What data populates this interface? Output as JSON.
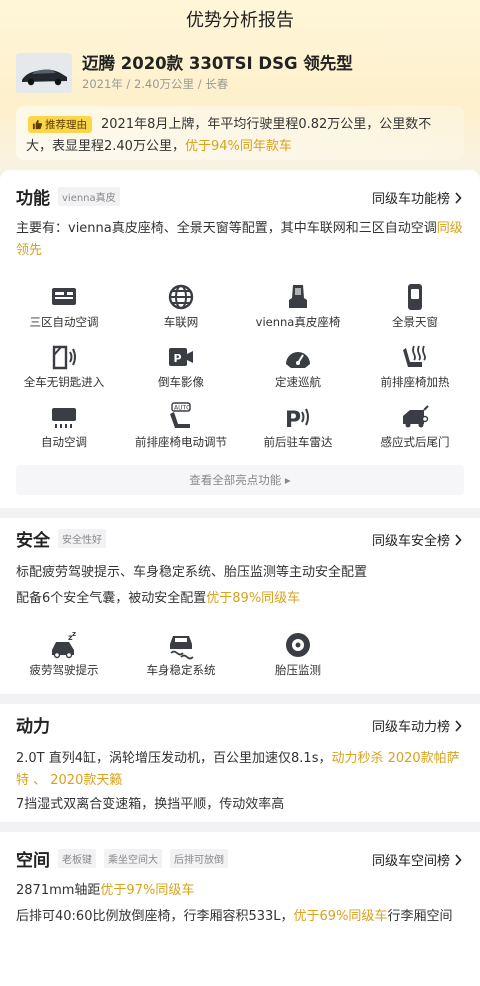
{
  "header": {
    "title": "优势分析报告"
  },
  "car": {
    "name": "迈腾 2020款 330TSI DSG 领先型",
    "meta": "2021年 / 2.40万公里 / 长春"
  },
  "reason": {
    "badge": "推荐理由",
    "text_plain": "2021年8月上牌，年平均行驶里程0.82万公里，公里数不大，表显里程2.40万公里，",
    "text_highlight": "优于94%同年款车"
  },
  "features": {
    "title": "功能",
    "tag": "vienna真皮",
    "rank_link": "同级车功能榜",
    "summary_plain": "主要有：vienna真皮座椅、全景天窗等配置，其中车联网和三区自动空调",
    "summary_highlight": "同级领先",
    "items": [
      {
        "label": "三区自动空调",
        "icon": "climate-panel-icon"
      },
      {
        "label": "车联网",
        "icon": "globe-icon"
      },
      {
        "label": "vienna真皮座椅",
        "icon": "seat-icon"
      },
      {
        "label": "全景天窗",
        "icon": "sunroof-icon"
      },
      {
        "label": "全车无钥匙进入",
        "icon": "door-key-icon"
      },
      {
        "label": "倒车影像",
        "icon": "reverse-camera-icon"
      },
      {
        "label": "定速巡航",
        "icon": "cruise-gauge-icon"
      },
      {
        "label": "前排座椅加热",
        "icon": "seat-heat-icon"
      },
      {
        "label": "自动空调",
        "icon": "ac-vent-icon"
      },
      {
        "label": "前排座椅电动调节",
        "icon": "power-seat-icon"
      },
      {
        "label": "前后驻车雷达",
        "icon": "parking-radar-icon"
      },
      {
        "label": "感应式后尾门",
        "icon": "tailgate-icon"
      }
    ],
    "more_label": "查看全部亮点功能 ▸"
  },
  "safety": {
    "title": "安全",
    "tag": "安全性好",
    "rank_link": "同级车安全榜",
    "line1": "标配疲劳驾驶提示、车身稳定系统、胎压监测等主动安全配置",
    "line2_plain": "配备6个安全气囊，被动安全配置",
    "line2_highlight": "优于89%同级车",
    "items": [
      {
        "label": "疲劳驾驶提示",
        "icon": "fatigue-warning-icon"
      },
      {
        "label": "车身稳定系统",
        "icon": "stability-control-icon"
      },
      {
        "label": "胎压监测",
        "icon": "tire-pressure-icon"
      }
    ]
  },
  "power": {
    "title": "动力",
    "rank_link": "同级车动力榜",
    "line1_plain": "2.0T 直列4缸，涡轮增压发动机，百公里加速仅8.1s，",
    "line1_highlight": "动力秒杀 2020款帕萨特 、 2020款天籁",
    "line2": "7挡湿式双离合变速箱，换挡平顺，传动效率高"
  },
  "space": {
    "title": "空间",
    "tags": [
      "老板键",
      "乘坐空间大",
      "后排可放倒"
    ],
    "rank_link": "同级车空间榜",
    "line1_plain": "2871mm轴距",
    "line1_highlight": "优于97%同级车",
    "line2_plain": "后排可40:60比例放倒座椅，行李厢容积533L，",
    "line2_highlight": "优于69%同级车",
    "line2_tail": "行李厢空间"
  },
  "colors": {
    "accent": "#d8a21d",
    "badge": "#fbd64a",
    "icon": "#3a3d44"
  }
}
